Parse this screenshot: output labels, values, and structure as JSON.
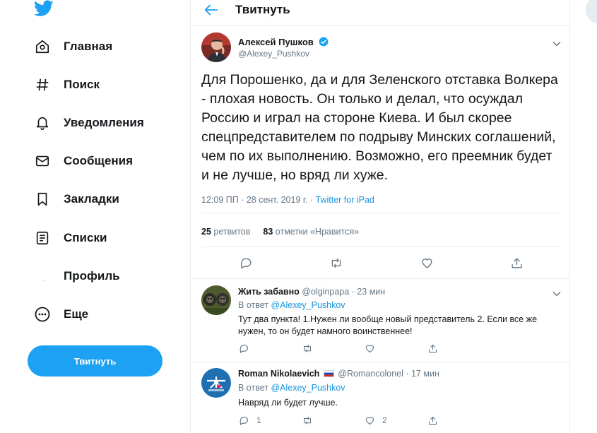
{
  "colors": {
    "accent": "#1da1f2",
    "text": "#14171a",
    "muted": "#657786",
    "link": "#1b95e0",
    "border": "#e6ecf0"
  },
  "sidebar": {
    "logo_icon": "twitter-bird-icon",
    "items": [
      {
        "label": "Главная",
        "icon": "home-icon"
      },
      {
        "label": "Поиск",
        "icon": "hashtag-icon"
      },
      {
        "label": "Уведомления",
        "icon": "bell-icon"
      },
      {
        "label": "Сообщения",
        "icon": "envelope-icon"
      },
      {
        "label": "Закладки",
        "icon": "bookmark-icon"
      },
      {
        "label": "Списки",
        "icon": "list-icon"
      },
      {
        "label": "Профиль",
        "icon": "profile-icon"
      },
      {
        "label": "Еще",
        "icon": "more-icon"
      }
    ],
    "tweet_button": "Твитнуть"
  },
  "header": {
    "title": "Твитнуть"
  },
  "tweet": {
    "author_name": "Алексей Пушков",
    "author_handle": "@Alexey_Pushkov",
    "text": "Для Порошенко, да и для Зеленского отставка Волкера - плохая новость. Он только и делал, что осуждал Россию и играл на стороне Киева. И был скорее спецпредставителем по подрыву Минских соглашений, чем по их выполнению. Возможно, его преемник будет и не лучше, но вряд ли хуже.",
    "time": "12:09 ПП · 28 сент. 2019 г. · ",
    "source": "Twitter for iPad",
    "retweets_count": "25",
    "retweets_label": "ретвитов",
    "likes_count": "83",
    "likes_label": "отметки «Нравится»"
  },
  "replies": [
    {
      "name": "Жить забавно",
      "meta": "@olginpapa · 23 мин",
      "reply_to_label": "В ответ ",
      "reply_to_handle": "@Alexey_Pushkov",
      "text": "Тут два пункта! 1.Нужен ли вообще новый представитель 2. Если все же нужен, то он будет намного воинственнее!",
      "reply_count": "",
      "like_count": ""
    },
    {
      "name": "Roman Nikolaevich",
      "meta": "@Romancolonel · 17 мин",
      "reply_to_label": "В ответ ",
      "reply_to_handle": "@Alexey_Pushkov",
      "text": "Навряд ли будет лучше.",
      "reply_count": "1",
      "like_count": "2"
    }
  ]
}
